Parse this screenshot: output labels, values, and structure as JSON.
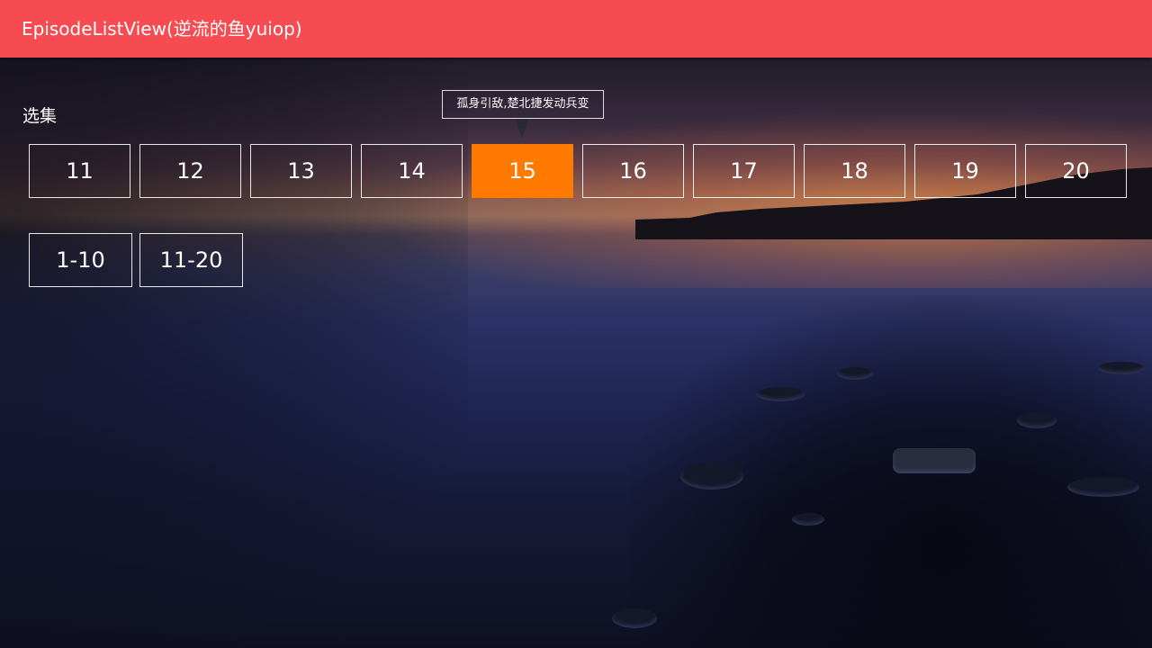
{
  "appbar": {
    "title": "EpisodeListView(逆流的鱼yuiop)",
    "color": "#f64b51"
  },
  "section": {
    "label": "选集"
  },
  "tooltip": {
    "text": "孤身引敌,楚北捷发动兵变"
  },
  "episodes": [
    {
      "label": "11",
      "focused": false
    },
    {
      "label": "12",
      "focused": false
    },
    {
      "label": "13",
      "focused": false
    },
    {
      "label": "14",
      "focused": false
    },
    {
      "label": "15",
      "focused": true
    },
    {
      "label": "16",
      "focused": false
    },
    {
      "label": "17",
      "focused": false
    },
    {
      "label": "18",
      "focused": false
    },
    {
      "label": "19",
      "focused": false
    },
    {
      "label": "20",
      "focused": false
    }
  ],
  "ranges": [
    {
      "label": "1-10"
    },
    {
      "label": "11-20"
    }
  ],
  "colors": {
    "focused": "#ff7a00",
    "border": "#ffffff"
  }
}
